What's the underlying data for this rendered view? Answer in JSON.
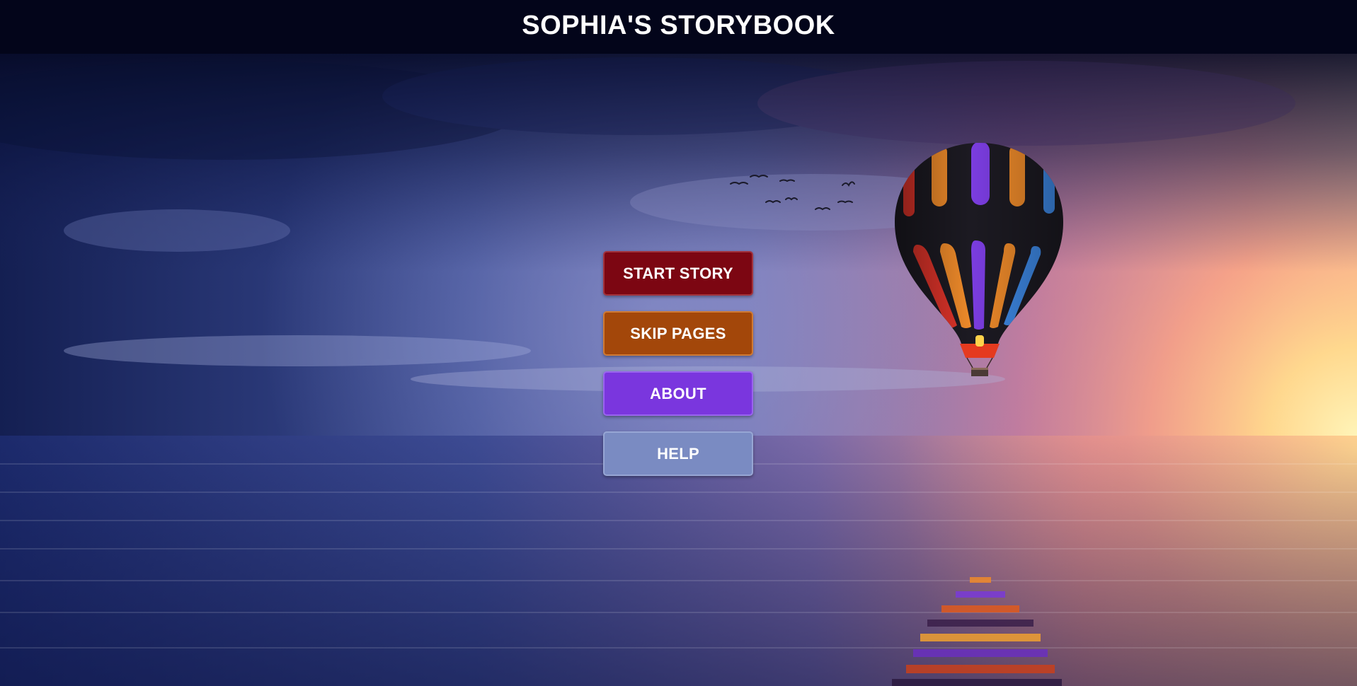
{
  "header": {
    "title": "SOPHIA'S STORYBOOK"
  },
  "menu": {
    "start_label": "START STORY",
    "skip_label": "SKIP PAGES",
    "about_label": "ABOUT",
    "help_label": "HELP"
  },
  "colors": {
    "header_bg": "#03051a",
    "start_button": "#7c0612",
    "skip_button": "#a3470a",
    "about_button": "#7a36de",
    "help_button": "#7a8bc2"
  },
  "background": {
    "scene": "hot-air-balloon-sunset-over-sea",
    "icons": [
      "hot-air-balloon-icon",
      "birds-icon"
    ]
  }
}
